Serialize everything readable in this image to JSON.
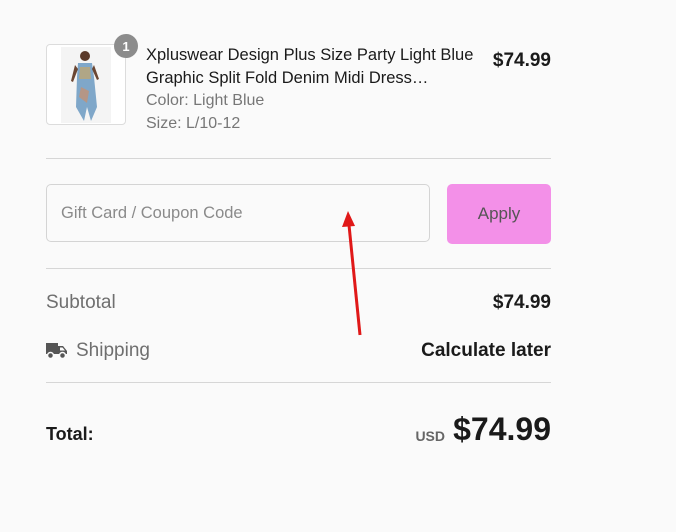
{
  "cart": {
    "item": {
      "quantity": "1",
      "name": "Xpluswear Design Plus Size Party Light Blue Graphic Split Fold Denim Midi Dress…",
      "color": "Color: Light Blue",
      "size": "Size: L/10-12",
      "price": "$74.99"
    }
  },
  "coupon": {
    "placeholder": "Gift Card / Coupon Code",
    "apply_label": "Apply"
  },
  "summary": {
    "subtotal_label": "Subtotal",
    "subtotal_value": "$74.99",
    "shipping_label": "Shipping",
    "shipping_value": "Calculate later",
    "total_label": "Total:",
    "currency": "USD",
    "total_value": "$74.99"
  },
  "icons": {
    "shipping": "truck-icon"
  },
  "colors": {
    "apply_button": "#f390e8",
    "annotation_arrow": "#e01818",
    "badge": "#8c8c8c"
  }
}
